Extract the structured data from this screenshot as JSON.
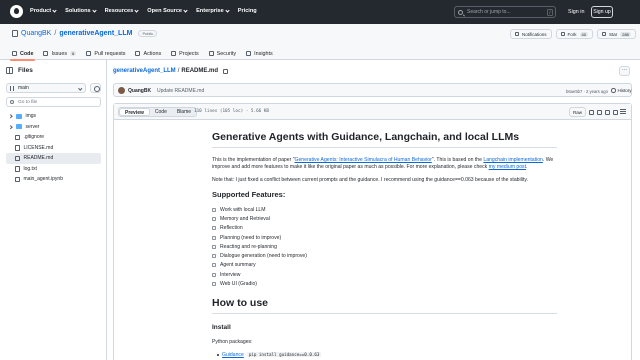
{
  "header": {
    "nav": [
      "Product",
      "Solutions",
      "Resources",
      "Open Source",
      "Enterprise",
      "Pricing"
    ],
    "nav_dropdowns": [
      true,
      true,
      true,
      true,
      true,
      false
    ],
    "search_placeholder": "Search or jump to...",
    "search_shortcut": "/",
    "sign_in": "Sign in",
    "sign_up": "Sign up"
  },
  "repo": {
    "owner": "QuangBK",
    "separator": "/",
    "name": "generativeAgent_LLM",
    "visibility": "Public",
    "actions": [
      {
        "label": "Notifications",
        "count": ""
      },
      {
        "label": "Fork",
        "count": "40"
      },
      {
        "label": "Star",
        "count": "285"
      }
    ],
    "tabs": [
      {
        "label": "Code",
        "count": "",
        "active": true
      },
      {
        "label": "Issues",
        "count": "6",
        "active": false
      },
      {
        "label": "Pull requests",
        "count": "",
        "active": false
      },
      {
        "label": "Actions",
        "count": "",
        "active": false
      },
      {
        "label": "Projects",
        "count": "",
        "active": false
      },
      {
        "label": "Security",
        "count": "",
        "active": false
      },
      {
        "label": "Insights",
        "count": "",
        "active": false
      }
    ]
  },
  "sidebar": {
    "title": "Files",
    "branch": "main",
    "goto_placeholder": "Go to file",
    "items": [
      {
        "label": "imgs",
        "type": "folder",
        "selected": false
      },
      {
        "label": "server",
        "type": "folder",
        "selected": false
      },
      {
        "label": ".gitignore",
        "type": "file",
        "selected": false
      },
      {
        "label": "LICENSE.md",
        "type": "file",
        "selected": false
      },
      {
        "label": "README.md",
        "type": "file",
        "selected": true
      },
      {
        "label": "log.txt",
        "type": "file",
        "selected": false
      },
      {
        "label": "main_agent.ipynb",
        "type": "file",
        "selected": false
      }
    ]
  },
  "main": {
    "breadcrumb_repo": "generativeAgent_LLM",
    "breadcrumb_sep": "/",
    "breadcrumb_file": "README.md",
    "commit": {
      "user": "QuangBK",
      "message": "Update README.md",
      "meta": "b6ae5b7 · 2 years ago",
      "history": "History"
    },
    "viewer": {
      "tabs": [
        "Preview",
        "Code",
        "Blame"
      ],
      "file_info": "110 lines (105 loc) · 5.66 KB",
      "raw": "Raw"
    }
  },
  "readme": {
    "title": "Generative Agents with Guidance, Langchain, and local LLMs",
    "intro_pre": "This is the implementation of paper \"",
    "intro_link1": "Generative Agents: Interactive Simulacra of Human Behavior",
    "intro_mid": "\". This is based on the ",
    "intro_link2": "Langchain implementation",
    "intro_post": ". We improve and add more features to make it like the original paper as much as possible. For more explanation, please check ",
    "intro_link3": "my medium post",
    "intro_end": ".",
    "note": "Note that: I just fixed a conflict between current prompts and the guidance. I recommend using the guidance==0.063 because of the stability.",
    "features_title": "Supported Features:",
    "features": [
      "Work with local LLM",
      "Memory and Retrieval",
      "Reflection",
      "Planning (need to improve)",
      "Reacting and re-planning",
      "Dialogue generation (need to improve)",
      "Agent summary",
      "Interview",
      "Web UI (Gradio)"
    ],
    "howto_title": "How to use",
    "install_title": "Install",
    "python_packages": "Python packages:",
    "pkg_name": "Guidance",
    "pkg_cmd": "pip install guidance==0.0.63"
  }
}
